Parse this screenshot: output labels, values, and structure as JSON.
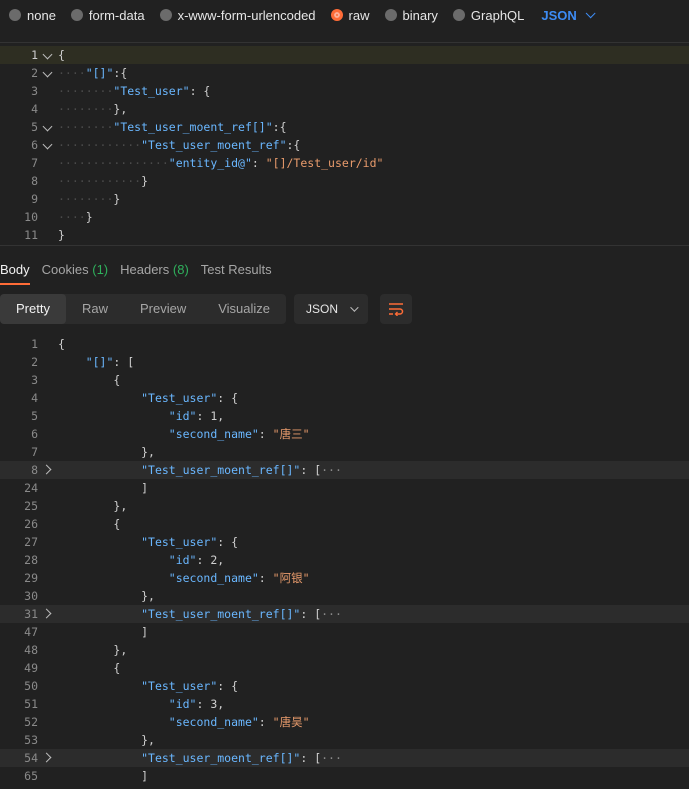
{
  "body_types": [
    {
      "label": "none",
      "selected": false
    },
    {
      "label": "form-data",
      "selected": false
    },
    {
      "label": "x-www-form-urlencoded",
      "selected": false
    },
    {
      "label": "raw",
      "selected": true
    },
    {
      "label": "binary",
      "selected": false
    },
    {
      "label": "GraphQL",
      "selected": false
    }
  ],
  "raw_language": "JSON",
  "request": {
    "lines": [
      {
        "n": "1",
        "tokens": [
          [
            "p",
            "{"
          ]
        ]
      },
      {
        "n": "2",
        "tokens": [
          [
            "ws",
            "····"
          ],
          [
            "k",
            "\"[]\""
          ],
          [
            "p",
            ":{"
          ]
        ]
      },
      {
        "n": "3",
        "tokens": [
          [
            "ws",
            "········"
          ],
          [
            "k",
            "\"Test_user\""
          ],
          [
            "p",
            ": {"
          ]
        ]
      },
      {
        "n": "4",
        "tokens": [
          [
            "ws",
            "········"
          ],
          [
            "p",
            "},"
          ]
        ]
      },
      {
        "n": "5",
        "tokens": [
          [
            "ws",
            "········"
          ],
          [
            "k",
            "\"Test_user_moent_ref[]\""
          ],
          [
            "p",
            ":{"
          ]
        ]
      },
      {
        "n": "6",
        "tokens": [
          [
            "ws",
            "············"
          ],
          [
            "k",
            "\"Test_user_moent_ref\""
          ],
          [
            "p",
            ":{"
          ]
        ]
      },
      {
        "n": "7",
        "tokens": [
          [
            "ws",
            "················"
          ],
          [
            "k",
            "\"entity_id@\""
          ],
          [
            "p",
            ": "
          ],
          [
            "s",
            "\"[]/Test_user/id\""
          ]
        ]
      },
      {
        "n": "8",
        "tokens": [
          [
            "ws",
            "············"
          ],
          [
            "p",
            "}"
          ]
        ]
      },
      {
        "n": "9",
        "tokens": [
          [
            "ws",
            "········"
          ],
          [
            "p",
            "}"
          ]
        ]
      },
      {
        "n": "10",
        "tokens": [
          [
            "ws",
            "····"
          ],
          [
            "p",
            "}"
          ]
        ]
      },
      {
        "n": "11",
        "tokens": [
          [
            "p",
            "}"
          ]
        ]
      }
    ]
  },
  "response_tabs": [
    {
      "label": "Body",
      "count": "",
      "active": true
    },
    {
      "label": "Cookies",
      "count": "(1)",
      "active": false
    },
    {
      "label": "Headers",
      "count": "(8)",
      "active": false
    },
    {
      "label": "Test Results",
      "count": "",
      "active": false
    }
  ],
  "view_modes": [
    {
      "label": "Pretty",
      "active": true
    },
    {
      "label": "Raw",
      "active": false
    },
    {
      "label": "Preview",
      "active": false
    },
    {
      "label": "Visualize",
      "active": false
    }
  ],
  "response_format": "JSON",
  "response": {
    "lines": [
      {
        "n": "1",
        "tokens": [
          [
            "p",
            "{"
          ]
        ]
      },
      {
        "n": "2",
        "tokens": [
          [
            "ws",
            "    "
          ],
          [
            "k",
            "\"[]\""
          ],
          [
            "p",
            ": ["
          ]
        ]
      },
      {
        "n": "3",
        "tokens": [
          [
            "ws",
            "        "
          ],
          [
            "p",
            "{"
          ]
        ]
      },
      {
        "n": "4",
        "tokens": [
          [
            "ws",
            "            "
          ],
          [
            "k",
            "\"Test_user\""
          ],
          [
            "p",
            ": {"
          ]
        ]
      },
      {
        "n": "5",
        "tokens": [
          [
            "ws",
            "                "
          ],
          [
            "k",
            "\"id\""
          ],
          [
            "p",
            ": 1,"
          ]
        ]
      },
      {
        "n": "6",
        "tokens": [
          [
            "ws",
            "                "
          ],
          [
            "k",
            "\"second_name\""
          ],
          [
            "p",
            ": "
          ],
          [
            "s",
            "\"唐三\""
          ]
        ]
      },
      {
        "n": "7",
        "tokens": [
          [
            "ws",
            "            "
          ],
          [
            "p",
            "},"
          ]
        ]
      },
      {
        "n": "8",
        "tokens": [
          [
            "ws",
            "            "
          ],
          [
            "k",
            "\"Test_user_moent_ref[]\""
          ],
          [
            "p",
            ": ["
          ],
          [
            "e",
            "···"
          ]
        ],
        "folded": true
      },
      {
        "n": "24",
        "tokens": [
          [
            "ws",
            "            "
          ],
          [
            "p",
            "]"
          ]
        ]
      },
      {
        "n": "25",
        "tokens": [
          [
            "ws",
            "        "
          ],
          [
            "p",
            "},"
          ]
        ]
      },
      {
        "n": "26",
        "tokens": [
          [
            "ws",
            "        "
          ],
          [
            "p",
            "{"
          ]
        ]
      },
      {
        "n": "27",
        "tokens": [
          [
            "ws",
            "            "
          ],
          [
            "k",
            "\"Test_user\""
          ],
          [
            "p",
            ": {"
          ]
        ]
      },
      {
        "n": "28",
        "tokens": [
          [
            "ws",
            "                "
          ],
          [
            "k",
            "\"id\""
          ],
          [
            "p",
            ": 2,"
          ]
        ]
      },
      {
        "n": "29",
        "tokens": [
          [
            "ws",
            "                "
          ],
          [
            "k",
            "\"second_name\""
          ],
          [
            "p",
            ": "
          ],
          [
            "s",
            "\"阿银\""
          ]
        ]
      },
      {
        "n": "30",
        "tokens": [
          [
            "ws",
            "            "
          ],
          [
            "p",
            "},"
          ]
        ]
      },
      {
        "n": "31",
        "tokens": [
          [
            "ws",
            "            "
          ],
          [
            "k",
            "\"Test_user_moent_ref[]\""
          ],
          [
            "p",
            ": ["
          ],
          [
            "e",
            "···"
          ]
        ],
        "folded": true
      },
      {
        "n": "47",
        "tokens": [
          [
            "ws",
            "            "
          ],
          [
            "p",
            "]"
          ]
        ]
      },
      {
        "n": "48",
        "tokens": [
          [
            "ws",
            "        "
          ],
          [
            "p",
            "},"
          ]
        ]
      },
      {
        "n": "49",
        "tokens": [
          [
            "ws",
            "        "
          ],
          [
            "p",
            "{"
          ]
        ]
      },
      {
        "n": "50",
        "tokens": [
          [
            "ws",
            "            "
          ],
          [
            "k",
            "\"Test_user\""
          ],
          [
            "p",
            ": {"
          ]
        ]
      },
      {
        "n": "51",
        "tokens": [
          [
            "ws",
            "                "
          ],
          [
            "k",
            "\"id\""
          ],
          [
            "p",
            ": 3,"
          ]
        ]
      },
      {
        "n": "52",
        "tokens": [
          [
            "ws",
            "                "
          ],
          [
            "k",
            "\"second_name\""
          ],
          [
            "p",
            ": "
          ],
          [
            "s",
            "\"唐昊\""
          ]
        ]
      },
      {
        "n": "53",
        "tokens": [
          [
            "ws",
            "            "
          ],
          [
            "p",
            "},"
          ]
        ]
      },
      {
        "n": "54",
        "tokens": [
          [
            "ws",
            "            "
          ],
          [
            "k",
            "\"Test_user_moent_ref[]\""
          ],
          [
            "p",
            ": ["
          ],
          [
            "e",
            "···"
          ]
        ],
        "folded": true
      },
      {
        "n": "65",
        "tokens": [
          [
            "ws",
            "            "
          ],
          [
            "p",
            "]"
          ]
        ]
      }
    ]
  }
}
